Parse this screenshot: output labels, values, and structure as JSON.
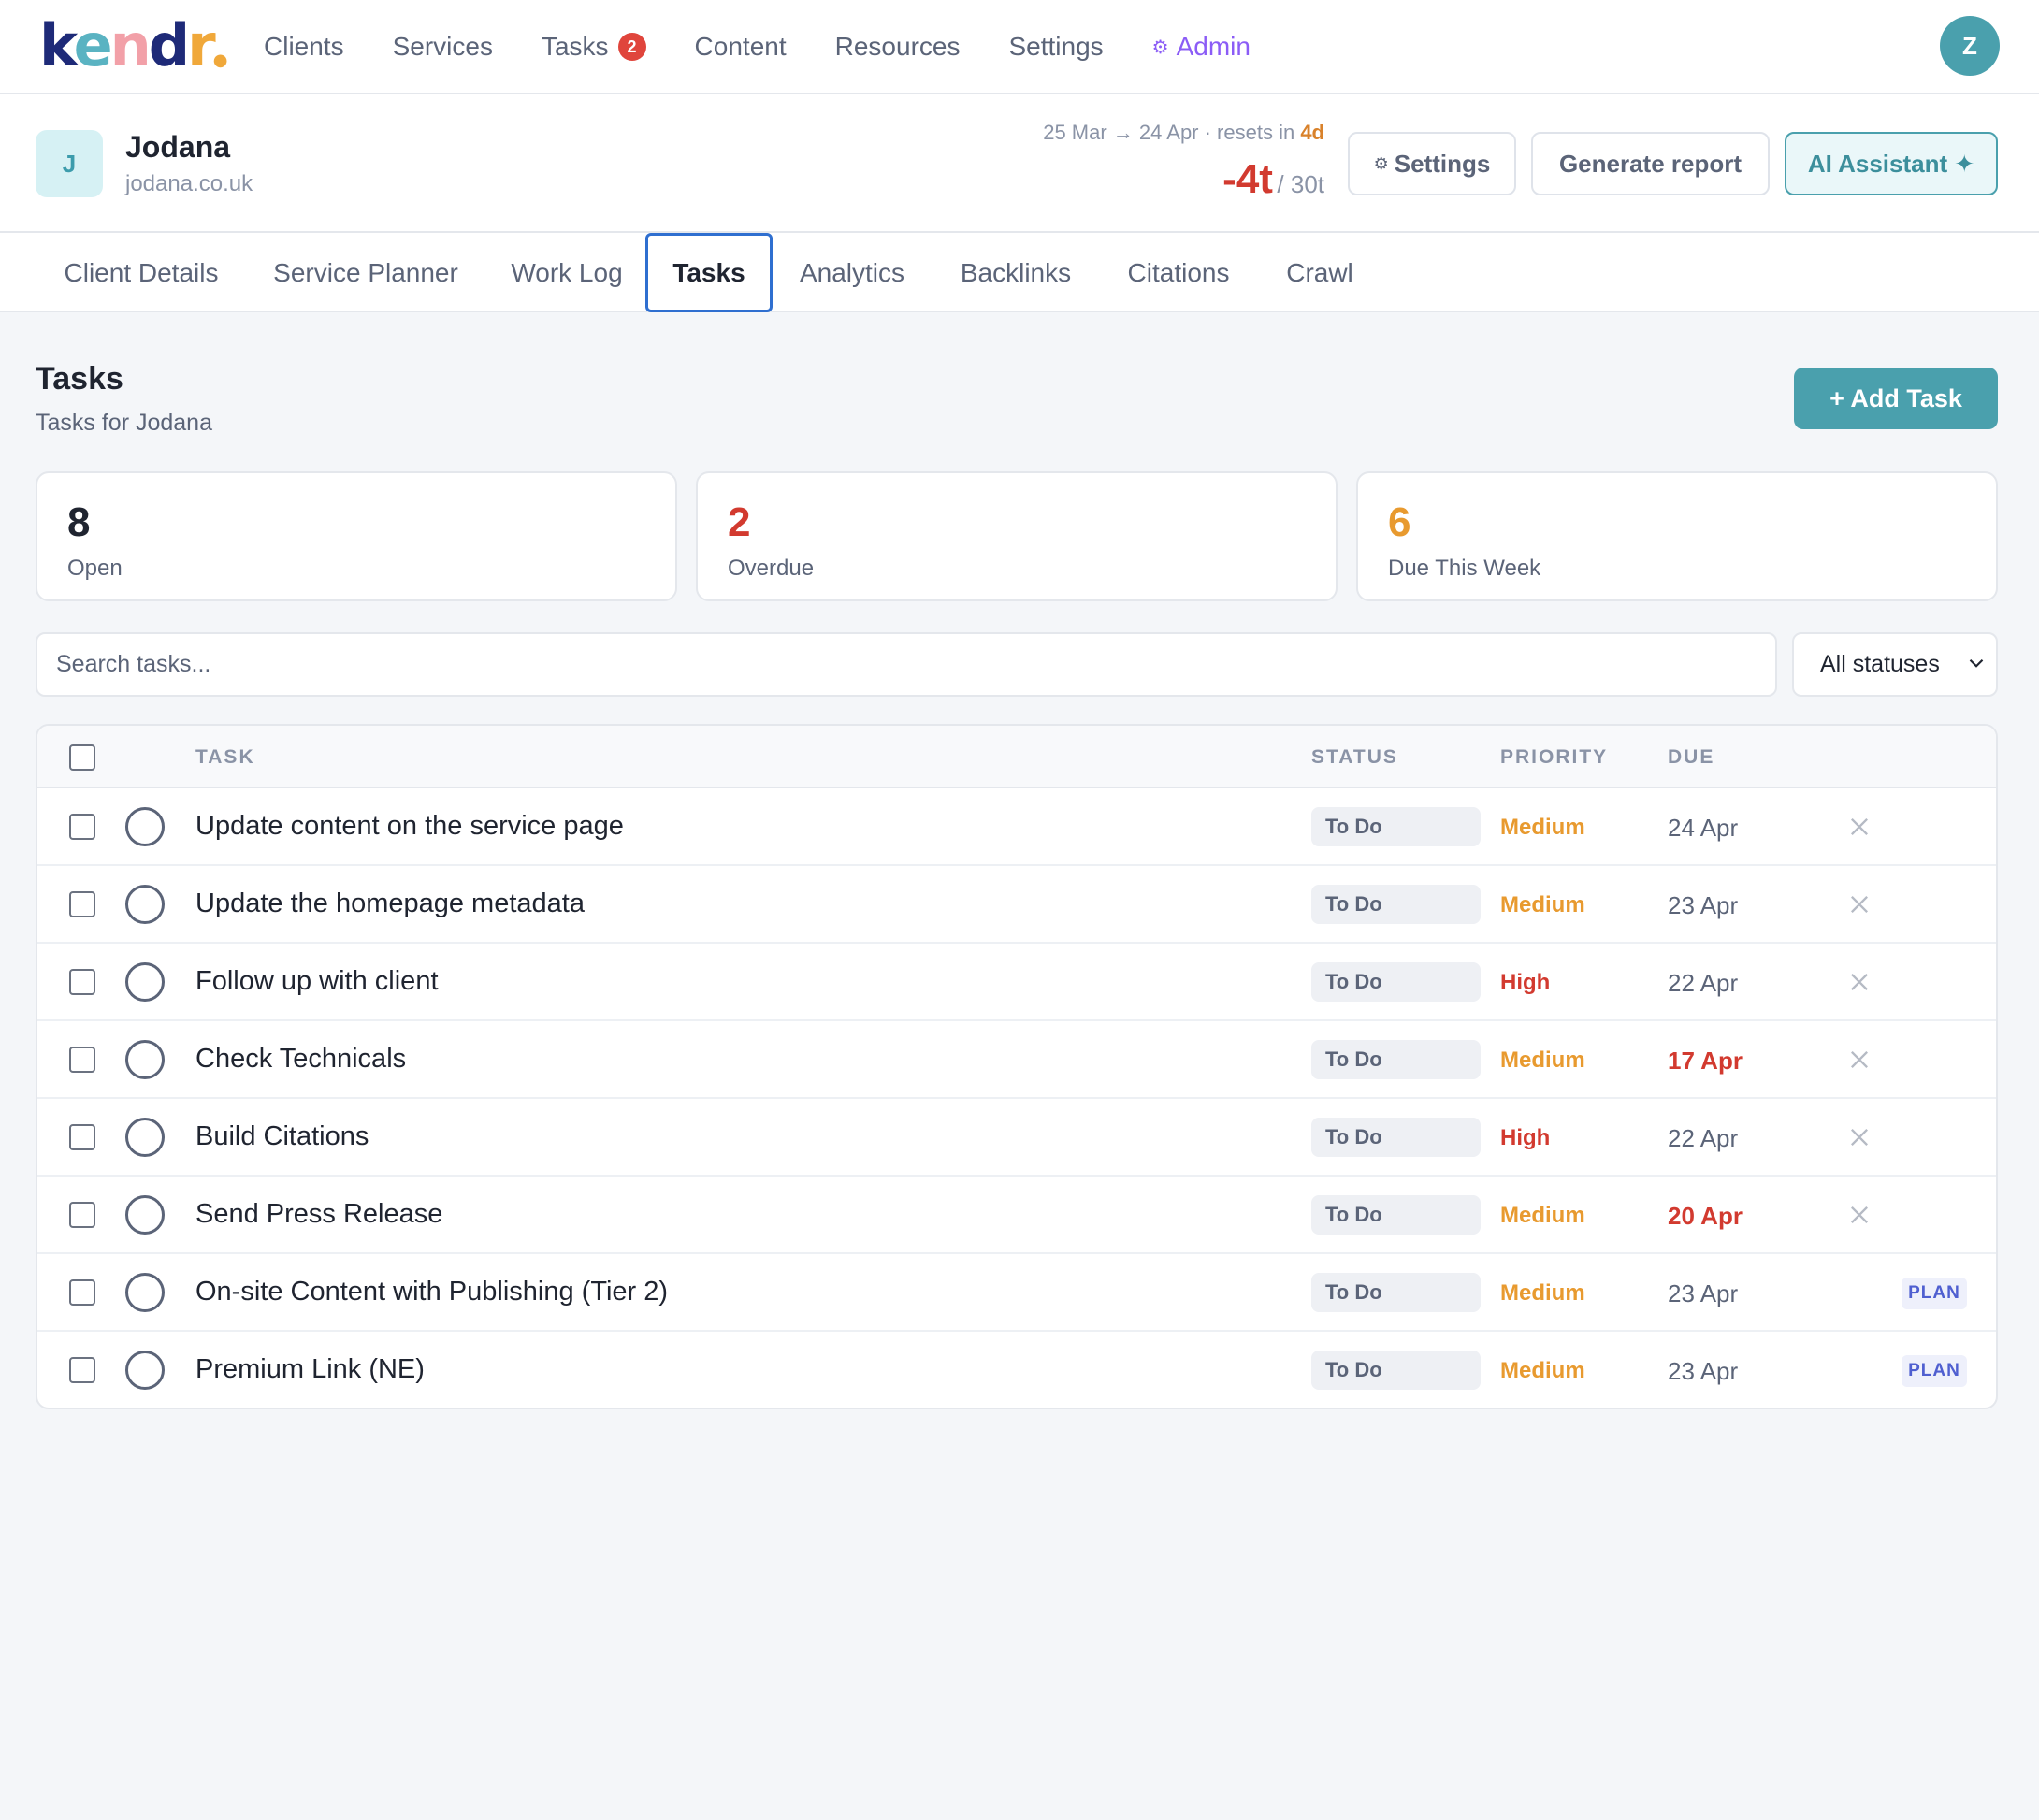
{
  "nav": {
    "logo": {
      "parts": [
        "k",
        "e",
        "n",
        "d",
        "r"
      ]
    },
    "links": [
      {
        "label": "Clients"
      },
      {
        "label": "Services"
      },
      {
        "label": "Tasks",
        "badge": "2"
      },
      {
        "label": "Content"
      },
      {
        "label": "Resources"
      },
      {
        "label": "Settings"
      },
      {
        "label": "Admin",
        "icon": "gear-icon"
      }
    ],
    "user_initial": "Z"
  },
  "client": {
    "initial": "J",
    "name": "Jodana",
    "domain": "jodana.co.uk",
    "period": "25 Mar → 24 Apr · resets in ",
    "resets": "4d",
    "credits_used": "-4t",
    "credits_total": "/ 30t"
  },
  "header_buttons": {
    "settings": "Settings",
    "report": "Generate report",
    "ai": "AI Assistant ✦"
  },
  "tabs": [
    "Client Details",
    "Service Planner",
    "Work Log",
    "Tasks",
    "Analytics",
    "Backlinks",
    "Citations",
    "Crawl"
  ],
  "active_tab": "Tasks",
  "section": {
    "title": "Tasks",
    "subtitle": "Tasks for Jodana",
    "add_button": "+ Add Task"
  },
  "stats": [
    {
      "value": "8",
      "label": "Open",
      "color": "#1f2430"
    },
    {
      "value": "2",
      "label": "Overdue",
      "color": "#d23a2f"
    },
    {
      "value": "6",
      "label": "Due This Week",
      "color": "#e89a2f"
    }
  ],
  "search": {
    "placeholder": "Search tasks..."
  },
  "filter": {
    "selected": "All statuses"
  },
  "table": {
    "headers": {
      "task": "TASK",
      "status": "STATUS",
      "priority": "PRIORITY",
      "due": "DUE"
    },
    "rows": [
      {
        "task": "Update content on the service page",
        "status": "To Do",
        "priority": "Medium",
        "due": "24 Apr",
        "overdue": false,
        "action": "remove"
      },
      {
        "task": "Update the homepage metadata",
        "status": "To Do",
        "priority": "Medium",
        "due": "23 Apr",
        "overdue": false,
        "action": "remove"
      },
      {
        "task": "Follow up with client",
        "status": "To Do",
        "priority": "High",
        "due": "22 Apr",
        "overdue": false,
        "action": "remove"
      },
      {
        "task": "Check Technicals",
        "status": "To Do",
        "priority": "Medium",
        "due": "17 Apr",
        "overdue": true,
        "action": "remove"
      },
      {
        "task": "Build Citations",
        "status": "To Do",
        "priority": "High",
        "due": "22 Apr",
        "overdue": false,
        "action": "remove"
      },
      {
        "task": "Send Press Release",
        "status": "To Do",
        "priority": "Medium",
        "due": "20 Apr",
        "overdue": true,
        "action": "remove"
      },
      {
        "task": "On-site Content with Publishing (Tier 2)",
        "status": "To Do",
        "priority": "Medium",
        "due": "23 Apr",
        "overdue": false,
        "action": "PLAN"
      },
      {
        "task": "Premium Link (NE)",
        "status": "To Do",
        "priority": "Medium",
        "due": "23 Apr",
        "overdue": false,
        "action": "PLAN"
      }
    ]
  }
}
